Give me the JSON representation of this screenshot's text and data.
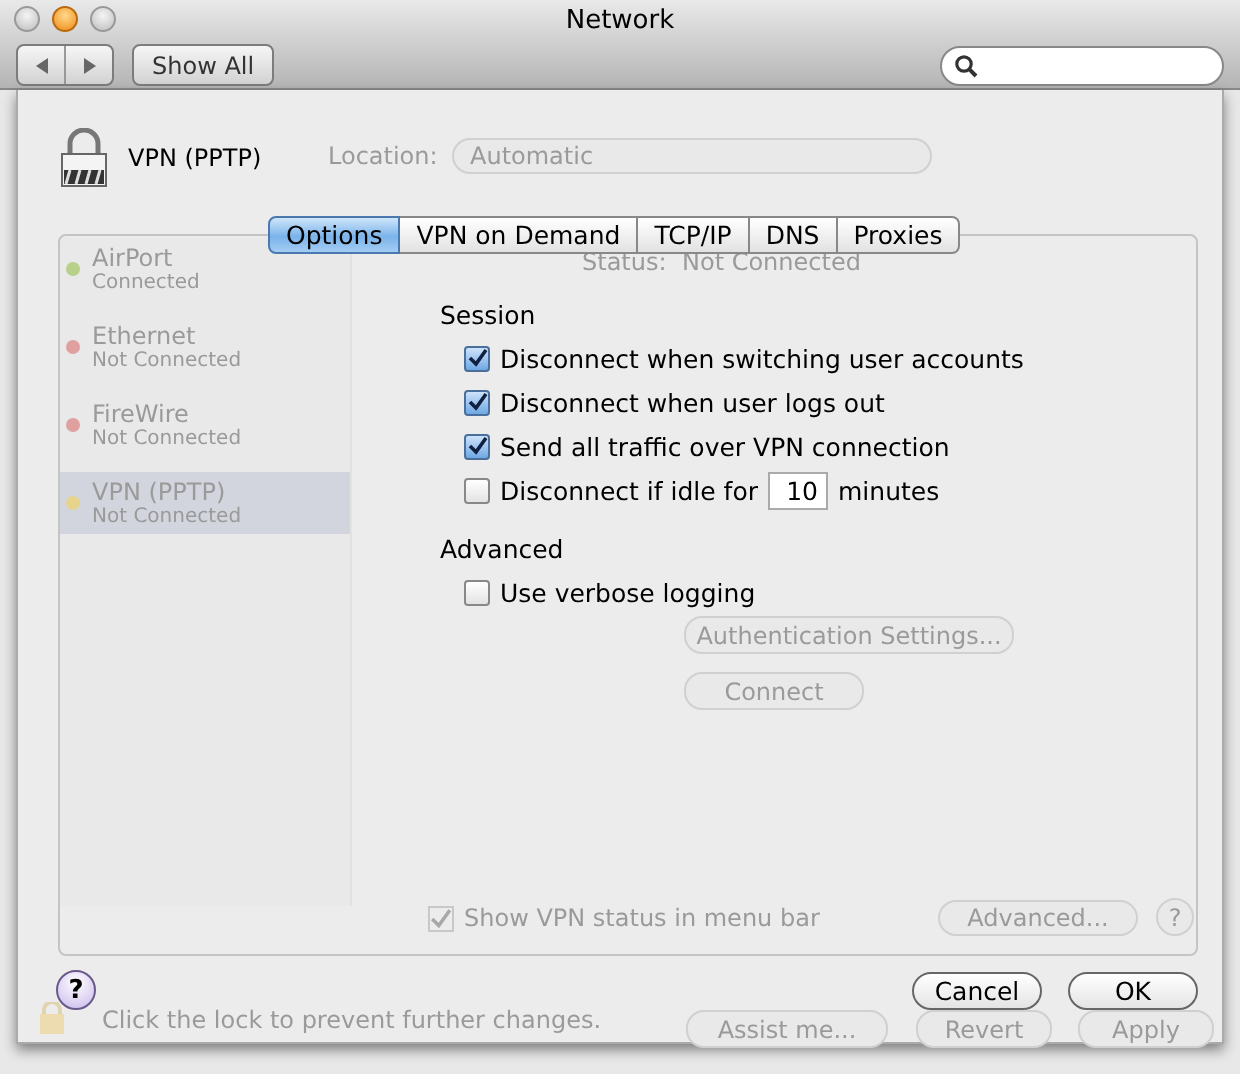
{
  "window": {
    "title": "Network",
    "show_all": "Show All"
  },
  "background": {
    "location_label": "Location:",
    "location_value": "Automatic",
    "services": [
      {
        "name": "AirPort",
        "status": "Connected",
        "selected": false,
        "color": "#b9d08a"
      },
      {
        "name": "Ethernet",
        "status": "Not Connected",
        "selected": false,
        "color": "#e0a0a0"
      },
      {
        "name": "FireWire",
        "status": "Not Connected",
        "selected": false,
        "color": "#e0a0a0"
      },
      {
        "name": "VPN (PPTP)",
        "status": "Not Connected",
        "selected": true,
        "color": "#e6d48c"
      }
    ],
    "status_label": "Status:",
    "status_value": "Not Connected",
    "auth_button": "Authentication Settings...",
    "connect_button": "Connect",
    "show_status": {
      "label": "Show VPN status in menu bar",
      "checked": true
    },
    "advanced_button": "Advanced...",
    "help": "?",
    "lock_text": "Click the lock to prevent further changes.",
    "footer_buttons": [
      "Assist me...",
      "Revert",
      "Apply"
    ]
  },
  "sheet": {
    "service_name": "VPN (PPTP)",
    "tabs": [
      {
        "label": "Options",
        "selected": true
      },
      {
        "label": "VPN on Demand",
        "selected": false
      },
      {
        "label": "TCP/IP",
        "selected": false
      },
      {
        "label": "DNS",
        "selected": false
      },
      {
        "label": "Proxies",
        "selected": false
      }
    ],
    "sections": [
      {
        "title": "Session",
        "options": [
          {
            "kind": "check",
            "label": "Disconnect when switching user accounts",
            "checked": true
          },
          {
            "kind": "check",
            "label": "Disconnect when user logs out",
            "checked": true
          },
          {
            "kind": "check",
            "label": "Send all traffic over VPN connection",
            "checked": true
          },
          {
            "kind": "idle",
            "label": "Disconnect if idle for",
            "checked": false,
            "value": "10",
            "suffix": "minutes"
          }
        ]
      },
      {
        "title": "Advanced",
        "options": [
          {
            "kind": "check",
            "label": "Use verbose logging",
            "checked": false
          }
        ]
      }
    ],
    "help": "?",
    "cancel": "Cancel",
    "ok": "OK"
  }
}
